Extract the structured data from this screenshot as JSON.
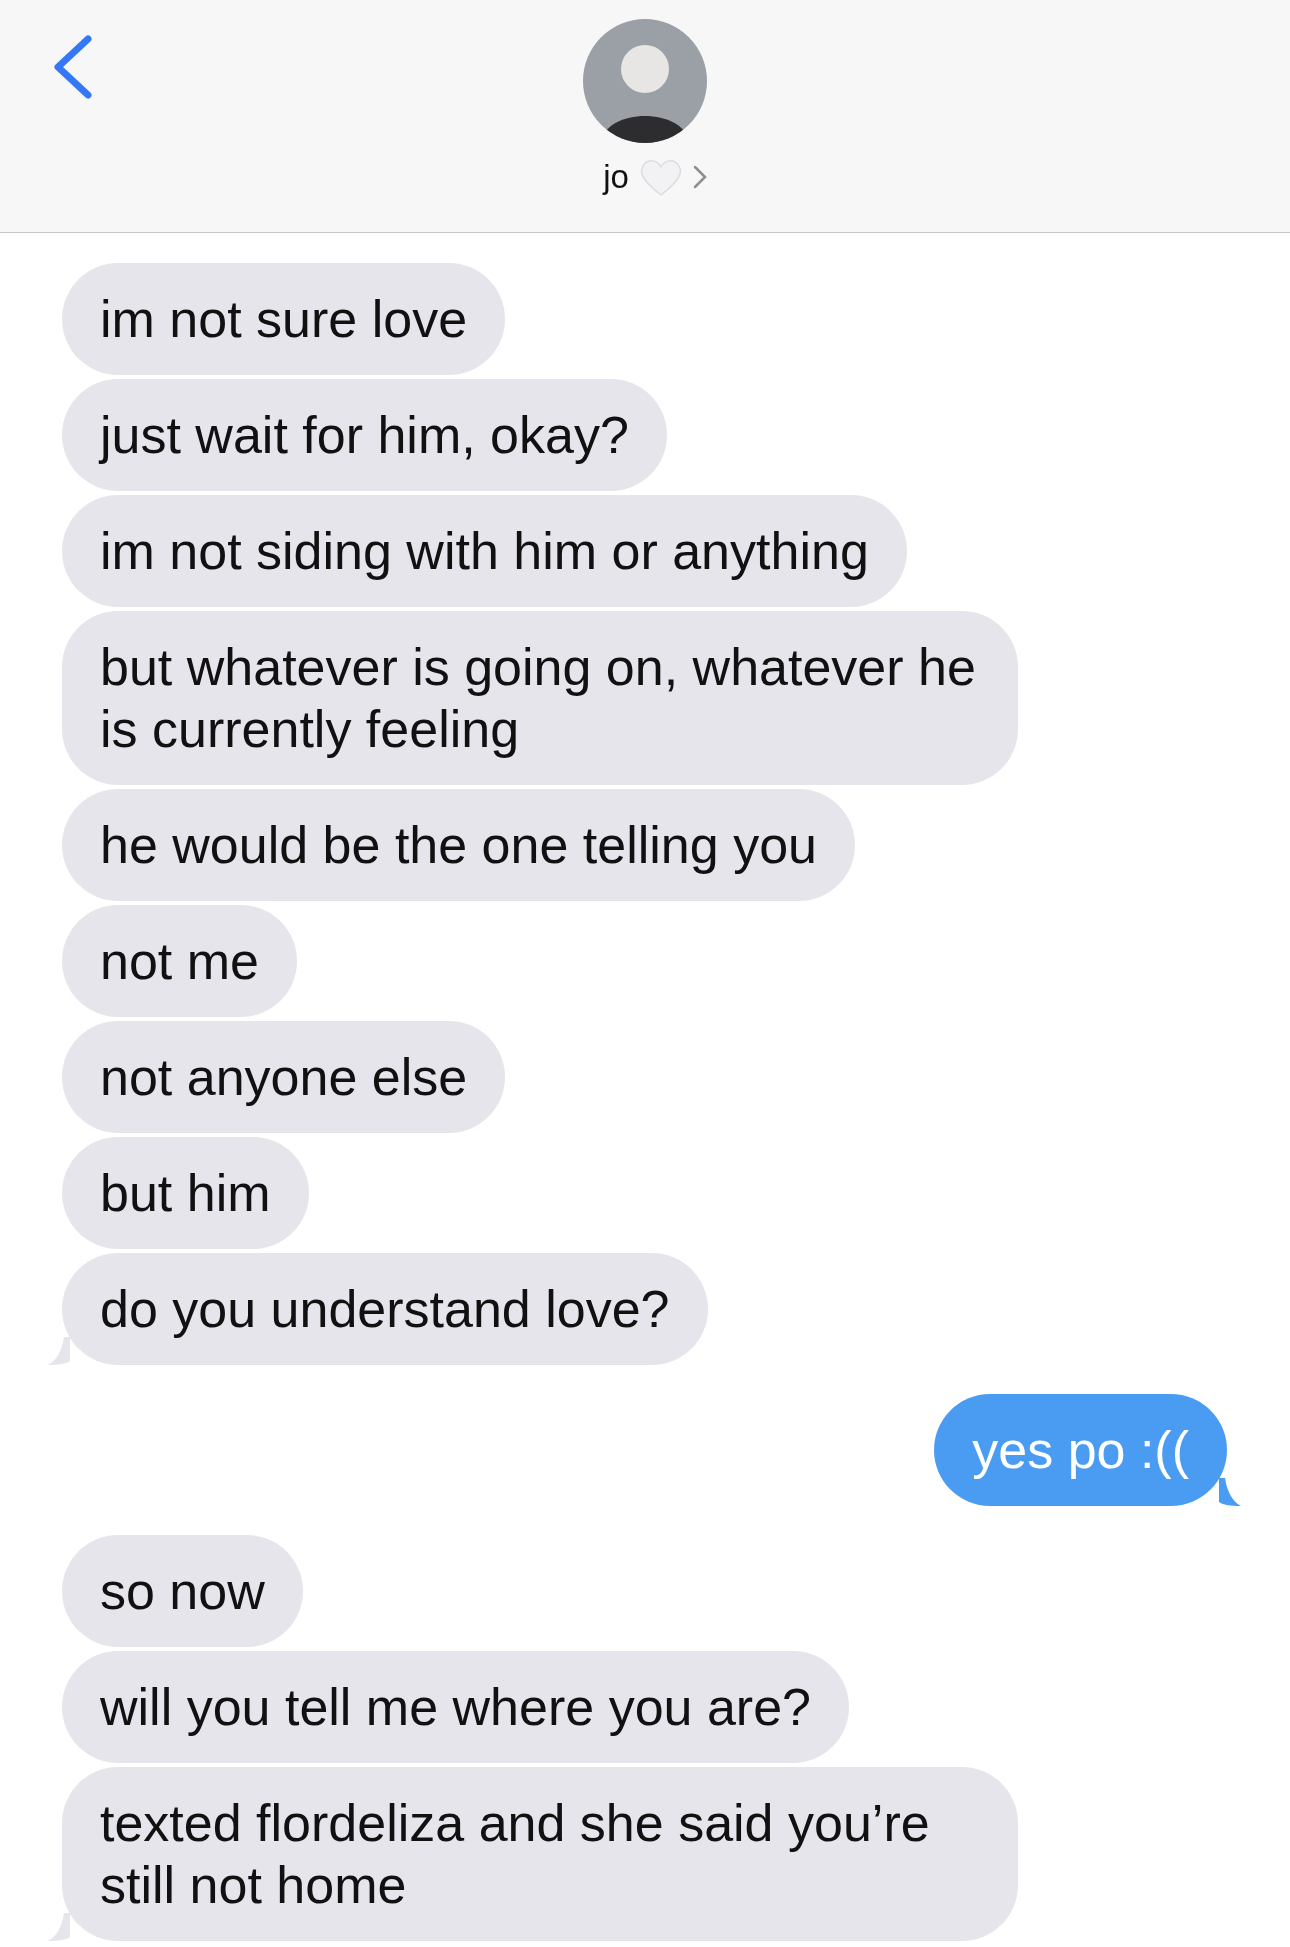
{
  "header": {
    "contact_name": "jo"
  },
  "messages": [
    {
      "kind": "received",
      "text": "im not sure love",
      "tail": false
    },
    {
      "kind": "received",
      "text": "just wait for him, okay?",
      "tail": false
    },
    {
      "kind": "received",
      "text": "im not siding with him or anything",
      "tail": false
    },
    {
      "kind": "received",
      "text": "but whatever is going on, whatever he is currently feeling",
      "tail": false
    },
    {
      "kind": "received",
      "text": "he would be the one telling you",
      "tail": false
    },
    {
      "kind": "received",
      "text": "not me",
      "tail": false
    },
    {
      "kind": "received",
      "text": "not anyone else",
      "tail": false
    },
    {
      "kind": "received",
      "text": "but him",
      "tail": false
    },
    {
      "kind": "received",
      "text": "do you understand love?",
      "tail": true
    },
    {
      "kind": "sent",
      "text": "yes po :((",
      "tail": true
    },
    {
      "kind": "received",
      "text": "so now",
      "tail": false
    },
    {
      "kind": "received",
      "text": "will you tell me where you are?",
      "tail": false
    },
    {
      "kind": "received",
      "text": "texted flordeliza and she said you’re still not home",
      "tail": true
    }
  ]
}
